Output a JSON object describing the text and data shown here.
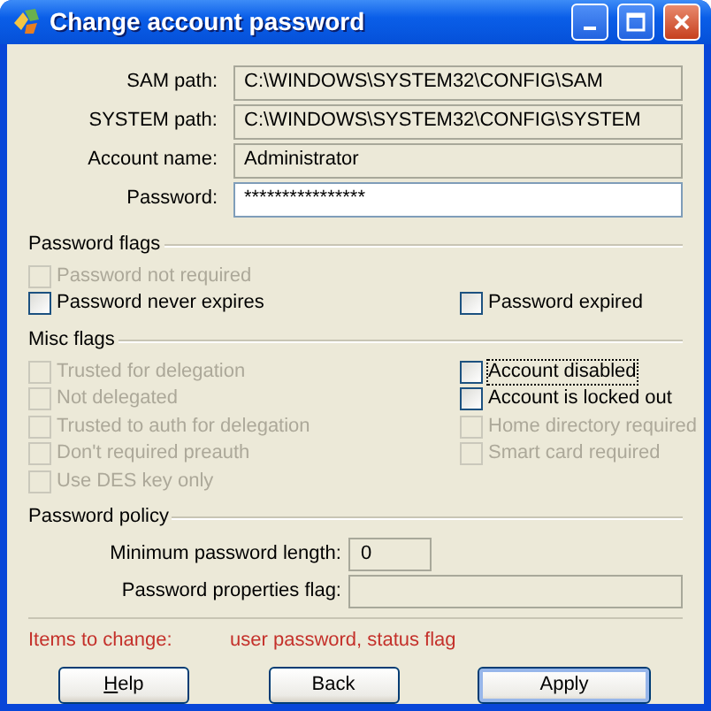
{
  "window": {
    "title": "Change account password"
  },
  "fields": [
    {
      "label": "SAM path:",
      "value": "C:\\WINDOWS\\SYSTEM32\\CONFIG\\SAM",
      "editable": false
    },
    {
      "label": "SYSTEM path:",
      "value": "C:\\WINDOWS\\SYSTEM32\\CONFIG\\SYSTEM",
      "editable": false
    },
    {
      "label": "Account name:",
      "value": "Administrator",
      "editable": false
    },
    {
      "label": "Password:",
      "value": "****************",
      "editable": true
    }
  ],
  "password_flags": {
    "title": "Password flags",
    "rows": [
      {
        "left": {
          "label": "Password not required",
          "checked": false,
          "disabled": true,
          "focused": false
        }
      },
      {
        "left": {
          "label": "Password never expires",
          "checked": false,
          "disabled": false,
          "focused": false
        },
        "right": {
          "label": "Password expired",
          "checked": false,
          "disabled": false,
          "focused": false
        }
      }
    ]
  },
  "misc_flags": {
    "title": "Misc flags",
    "rows": [
      {
        "left": {
          "label": "Trusted for delegation",
          "checked": false,
          "disabled": true,
          "focused": false
        },
        "right": {
          "label": "Account disabled",
          "checked": false,
          "disabled": false,
          "focused": true
        }
      },
      {
        "left": {
          "label": "Not delegated",
          "checked": false,
          "disabled": true,
          "focused": false
        },
        "right": {
          "label": "Account is locked out",
          "checked": false,
          "disabled": false,
          "focused": false
        }
      },
      {
        "left": {
          "label": "Trusted to auth for delegation",
          "checked": false,
          "disabled": true,
          "focused": false
        },
        "right": {
          "label": "Home directory required",
          "checked": false,
          "disabled": true,
          "focused": false
        }
      },
      {
        "left": {
          "label": "Don't required preauth",
          "checked": false,
          "disabled": true,
          "focused": false
        },
        "right": {
          "label": "Smart card required",
          "checked": false,
          "disabled": true,
          "focused": false
        }
      },
      {
        "left": {
          "label": "Use DES key only",
          "checked": false,
          "disabled": true,
          "focused": false
        }
      }
    ]
  },
  "password_policy": {
    "title": "Password policy",
    "fields": [
      {
        "label": "Minimum password length:",
        "value": "0",
        "kind": "short"
      },
      {
        "label": "Password properties flag:",
        "kind": "wide"
      }
    ]
  },
  "status": {
    "label": "Items to change:",
    "value": "user password, status flag"
  },
  "buttons": [
    {
      "label": "Help",
      "mnemonic": true,
      "default": false
    },
    {
      "label": "Back",
      "mnemonic": false,
      "default": false
    },
    {
      "label": "Apply",
      "mnemonic": false,
      "default": true
    }
  ]
}
